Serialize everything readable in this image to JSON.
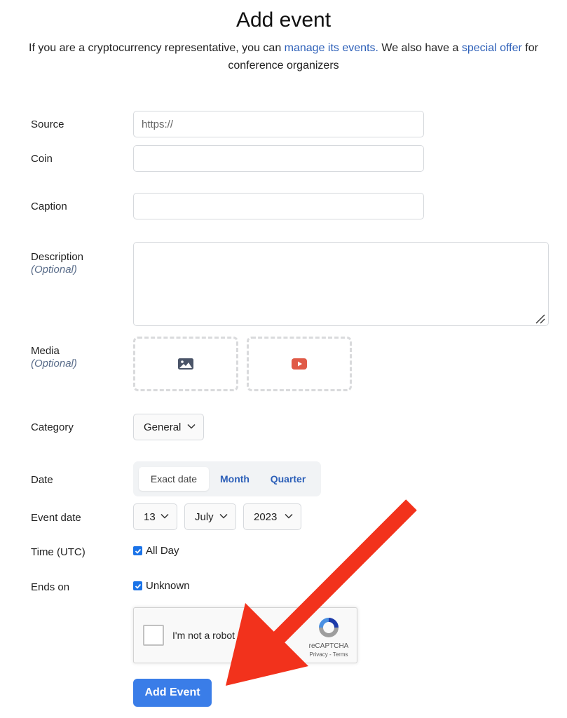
{
  "page": {
    "title": "Add event",
    "intro": {
      "text_before": "If you are a cryptocurrency representative, you can ",
      "link_manage": "manage its events.",
      "text_middle": " We also have a ",
      "link_offer": "special offer",
      "text_after": " for conference organizers"
    }
  },
  "form": {
    "source": {
      "label": "Source",
      "placeholder": "https://"
    },
    "coin": {
      "label": "Coin"
    },
    "caption": {
      "label": "Caption"
    },
    "description": {
      "label": "Description",
      "optional": "(Optional)"
    },
    "media": {
      "label": "Media",
      "optional": "(Optional)",
      "image_icon": "image-icon",
      "video_icon": "youtube-icon"
    },
    "category": {
      "label": "Category",
      "value": "General"
    },
    "date": {
      "label": "Date",
      "options": [
        "Exact date",
        "Month",
        "Quarter"
      ],
      "selected": "Exact date"
    },
    "event_date": {
      "label": "Event date",
      "day": "13",
      "month": "July",
      "year": "2023"
    },
    "time": {
      "label": "Time (UTC)",
      "checkbox_label": "All Day",
      "checked": true
    },
    "ends_on": {
      "label": "Ends on",
      "checkbox_label": "Unknown",
      "checked": true
    },
    "recaptcha": {
      "label": "I'm not a robot",
      "brand": "reCAPTCHA",
      "links": "Privacy - Terms"
    },
    "submit_label": "Add Event"
  },
  "colors": {
    "link": "#2c5fb8",
    "primary_button": "#3a7de8",
    "annotation_arrow": "#f2321c",
    "video_icon": "#e05a47",
    "image_icon": "#4a5468"
  }
}
